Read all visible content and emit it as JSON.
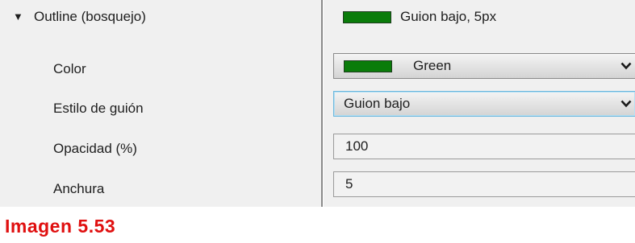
{
  "section": {
    "label": "Outline (bosquejo)",
    "summary": "Guion bajo, 5px",
    "summary_swatch_color": "#0a7c0a",
    "expanded_icon": "triangle-down-icon"
  },
  "properties": {
    "color": {
      "label": "Color",
      "value": "Green",
      "swatch_color": "#0a7c0a"
    },
    "dash_style": {
      "label": "Estilo de guión",
      "value": "Guion bajo"
    },
    "opacity": {
      "label": "Opacidad (%)",
      "value": "100"
    },
    "width": {
      "label": "Anchura",
      "value": "5"
    }
  },
  "caption": "Imagen 5.53",
  "colors": {
    "caption": "#e01010",
    "panel_background": "#f0f0f0",
    "focus_border": "#6ab7dd"
  }
}
